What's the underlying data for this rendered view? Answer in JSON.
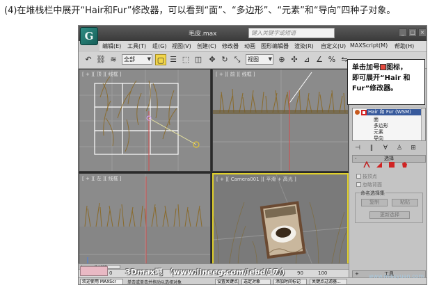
{
  "caption": "(4)在堆栈栏中展开“Hair和Fur”修改器，可以看到“面”、“多边形”、“元素”和“导向”四种子对象。",
  "app": {
    "logo": "G",
    "title": "毛皮.max",
    "search_placeholder": "键入关键字或短语",
    "window_buttons": [
      "_",
      "□",
      "×"
    ]
  },
  "menu": [
    "编辑(E)",
    "工具(T)",
    "组(G)",
    "视图(V)",
    "创建(C)",
    "修改器",
    "动画",
    "图形编辑器",
    "渲染(R)",
    "自定义(U)",
    "MAXScript(M)",
    "帮助(H)"
  ],
  "toolbar": {
    "filter_value": "全部",
    "view_value": "视图"
  },
  "viewports": {
    "top": "[ + ][ 顶 ][ 线框 ]",
    "front": "[ + ][ 前 ][ 线框 ]",
    "left": "[ + ][ 左 ][ 线框 ]",
    "camera": "[ + ][ Camera001 ][ 平滑 + 高光 ]"
  },
  "callout": {
    "line1_prefix": "单击加号",
    "line1_suffix": "图标，",
    "line2": "即可展开“Hair 和",
    "line3": "Fur”修改器。"
  },
  "stack": {
    "modifier": "Hair 和 Fur (WSM)",
    "subobjects": [
      "面",
      "多边形",
      "元素",
      "导向"
    ]
  },
  "panel": {
    "rollout_select": "选择",
    "rollout_tools": "工具",
    "rollout_design": "设计",
    "by_vertex": "按顶点",
    "ignore_backface": "忽略背面",
    "named_sets": "命名选择集",
    "copy": "复制",
    "paste": "粘贴",
    "update_selection": "更新选择"
  },
  "timeline": {
    "slider": "0 / 100",
    "ticks": [
      "0",
      "10",
      "20",
      "30",
      "40",
      "50",
      "60",
      "70",
      "80",
      "90",
      "100"
    ]
  },
  "status": {
    "welcome": "欢迎使用 MAXScr",
    "prompt": "单击或单击并拖动以选择对象",
    "set_key": "设置关键点",
    "selected": "选定对象",
    "add_time_tag": "添加时间标记",
    "key_filter": "关键点过滤器..."
  },
  "watermark": {
    "main": "3Dmax吧 （www.lineeg.com/iebd/17/）",
    "corner": "www.missyuan.com"
  },
  "colors": {
    "active_viewport": "#e1d12a",
    "selected_modifier": "#385a9c",
    "grass": "#8a6a2a"
  }
}
